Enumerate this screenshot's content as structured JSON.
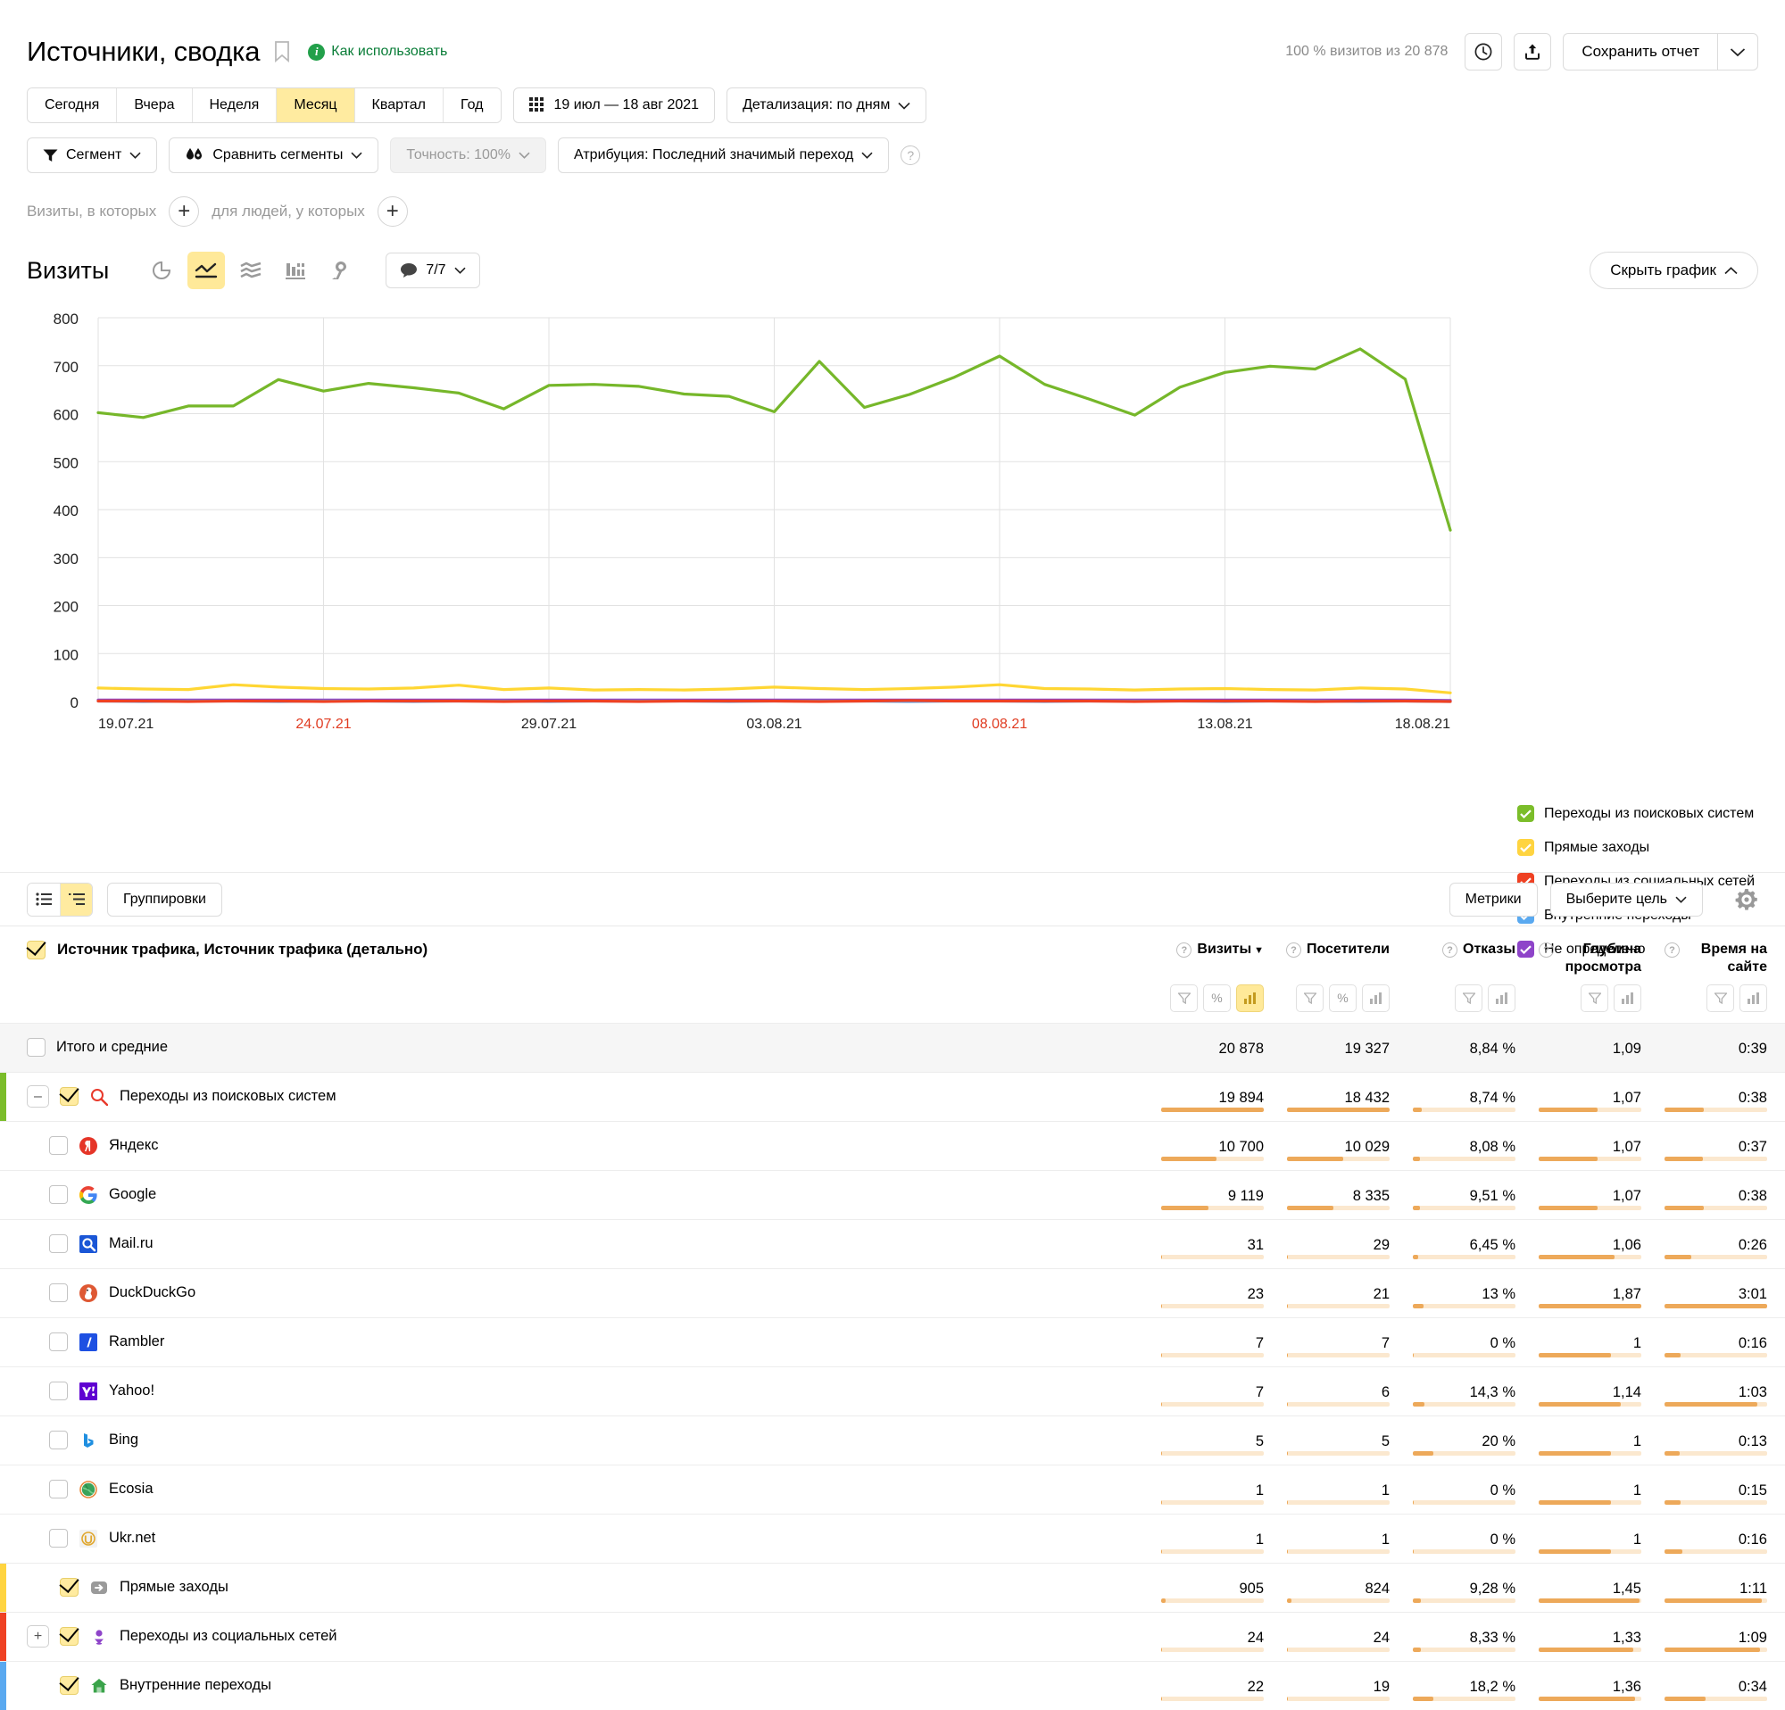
{
  "header": {
    "title": "Источники, сводка",
    "howto": "Как использовать",
    "visits_meta": "100 % визитов из 20 878",
    "save_label": "Сохранить отчет",
    "icons": {
      "bookmark": "bookmark-icon",
      "history": "clock-icon",
      "export": "export-icon"
    }
  },
  "period": {
    "items": [
      "Сегодня",
      "Вчера",
      "Неделя",
      "Месяц",
      "Квартал",
      "Год"
    ],
    "active": "Месяц",
    "date_range": "19 июл — 18 авг 2021",
    "detail": "Детализация: по дням"
  },
  "filters": {
    "segment": "Сегмент",
    "compare": "Сравнить сегменты",
    "accuracy": "Точность: 100%",
    "attribution": "Атрибуция: Последний значимый переход",
    "visits_label": "Визиты, в которых",
    "people_label": "для людей, у которых",
    "plus": "+"
  },
  "chart_controls": {
    "metric": "Визиты",
    "comments": "7/7",
    "hide_chart": "Скрыть график",
    "viz_buttons": [
      "pie-chart-icon",
      "line-chart-icon",
      "area-chart-icon",
      "bar-chart-icon",
      "map-icon"
    ],
    "active_viz": "line-chart-icon"
  },
  "chart_data": {
    "type": "line",
    "title": "Визиты",
    "xlabel": "",
    "ylabel": "",
    "ylim": [
      0,
      800
    ],
    "yticks": [
      0,
      100,
      200,
      300,
      400,
      500,
      600,
      700,
      800
    ],
    "grid": true,
    "legend_position": "right",
    "x": [
      "19.07.21",
      "20.07.21",
      "21.07.21",
      "22.07.21",
      "23.07.21",
      "24.07.21",
      "25.07.21",
      "26.07.21",
      "27.07.21",
      "28.07.21",
      "29.07.21",
      "30.07.21",
      "31.07.21",
      "01.08.21",
      "02.08.21",
      "03.08.21",
      "04.08.21",
      "05.08.21",
      "06.08.21",
      "07.08.21",
      "08.08.21",
      "09.08.21",
      "10.08.21",
      "11.08.21",
      "12.08.21",
      "13.08.21",
      "14.08.21",
      "15.08.21",
      "16.08.21",
      "17.08.21",
      "18.08.21"
    ],
    "xtick_labels": [
      "19.07.21",
      "24.07.21",
      "29.07.21",
      "03.08.21",
      "08.08.21",
      "13.08.21",
      "18.08.21"
    ],
    "xtick_weekend": [
      "24.07.21",
      "08.08.21"
    ],
    "series": [
      {
        "name": "Переходы из поисковых систем",
        "color": "#76b72a",
        "values": [
          602,
          592,
          616,
          616,
          671,
          647,
          663,
          654,
          643,
          610,
          659,
          661,
          657,
          641,
          636,
          604,
          709,
          613,
          640,
          676,
          720,
          661,
          630,
          597,
          655,
          686,
          699,
          693,
          735,
          672,
          357
        ]
      },
      {
        "name": "Прямые заходы",
        "color": "#ffd633",
        "values": [
          28,
          26,
          25,
          35,
          30,
          27,
          26,
          28,
          34,
          25,
          28,
          24,
          25,
          24,
          26,
          30,
          27,
          25,
          27,
          30,
          35,
          27,
          26,
          24,
          26,
          27,
          25,
          24,
          28,
          26,
          18
        ]
      },
      {
        "name": "Переходы из социальных сетей",
        "color": "#ef4123",
        "values": [
          1,
          1,
          0,
          1,
          1,
          0,
          1,
          1,
          1,
          0,
          1,
          1,
          0,
          1,
          1,
          1,
          0,
          1,
          2,
          1,
          1,
          1,
          1,
          0,
          1,
          1,
          1,
          0,
          1,
          1,
          0
        ]
      },
      {
        "name": "Внутренние переходы",
        "color": "#5aa9f0",
        "values": [
          1,
          0,
          1,
          1,
          0,
          1,
          1,
          0,
          1,
          1,
          0,
          1,
          1,
          1,
          0,
          1,
          1,
          1,
          0,
          1,
          1,
          0,
          1,
          1,
          1,
          0,
          1,
          1,
          0,
          1,
          0
        ]
      },
      {
        "name": "Не определено",
        "color": "#8e44c9",
        "values": [
          3,
          3,
          3,
          3,
          3,
          3,
          3,
          3,
          3,
          3,
          3,
          3,
          3,
          3,
          3,
          3,
          3,
          3,
          3,
          3,
          3,
          3,
          3,
          3,
          3,
          3,
          3,
          3,
          3,
          3,
          2
        ]
      }
    ]
  },
  "legend": [
    {
      "label": "Переходы из поисковых систем",
      "color": "#7bbd2a",
      "checked": true
    },
    {
      "label": "Прямые заходы",
      "color": "#ffd440",
      "checked": true
    },
    {
      "label": "Переходы из социальных сетей",
      "color": "#ef4123",
      "checked": true
    },
    {
      "label": "Внутренние переходы",
      "color": "#5aa9f0",
      "checked": true
    },
    {
      "label": "Не определено",
      "color": "#8e44c9",
      "checked": true
    }
  ],
  "table_toolbar": {
    "groupings": "Группировки",
    "metrics": "Метрики",
    "goal": "Выберите цель"
  },
  "table": {
    "dimension_header": "Источник трафика, Источник трафика (детально)",
    "columns": [
      {
        "label": "Визиты",
        "sorted": true
      },
      {
        "label": "Посетители",
        "sorted": false
      },
      {
        "label": "Отказы",
        "sorted": false
      },
      {
        "label": "Глубина просмотра",
        "sorted": false
      },
      {
        "label": "Время на сайте",
        "sorted": false
      }
    ],
    "rows": [
      {
        "label": "Итого и средние",
        "icon": "",
        "accent": "",
        "checked": false,
        "expander": "",
        "indent": 0,
        "total": true,
        "values": [
          "20 878",
          "19 327",
          "8,84 %",
          "1,09",
          "0:39"
        ],
        "bars": [
          0,
          0,
          0,
          0,
          0
        ]
      },
      {
        "label": "Переходы из поисковых систем",
        "icon": "search-icon",
        "accent": "#7bbd2a",
        "checked": true,
        "expander": "−",
        "indent": 0,
        "total": false,
        "values": [
          "19 894",
          "18 432",
          "8,74 %",
          "1,07",
          "0:38"
        ],
        "bars": [
          100,
          100,
          8.8,
          57,
          38
        ]
      },
      {
        "label": "Яндекс",
        "icon": "yandex-icon",
        "accent": "",
        "checked": false,
        "expander": "",
        "indent": 1,
        "total": false,
        "values": [
          "10 700",
          "10 029",
          "8,08 %",
          "1,07",
          "0:37"
        ],
        "bars": [
          54,
          55,
          7,
          57,
          37
        ]
      },
      {
        "label": "Google",
        "icon": "google-icon",
        "accent": "",
        "checked": false,
        "expander": "",
        "indent": 1,
        "total": false,
        "values": [
          "9 119",
          "8 335",
          "9,51 %",
          "1,07",
          "0:38"
        ],
        "bars": [
          46,
          45,
          7,
          57,
          38
        ]
      },
      {
        "label": "Mail.ru",
        "icon": "mailru-icon",
        "accent": "",
        "checked": false,
        "expander": "",
        "indent": 1,
        "total": false,
        "values": [
          "31",
          "29",
          "6,45 %",
          "1,06",
          "0:26"
        ],
        "bars": [
          0.6,
          0.6,
          5,
          74,
          26
        ]
      },
      {
        "label": "DuckDuckGo",
        "icon": "duckduckgo-icon",
        "accent": "",
        "checked": false,
        "expander": "",
        "indent": 1,
        "total": false,
        "values": [
          "23",
          "21",
          "13 %",
          "1,87",
          "3:01"
        ],
        "bars": [
          0.5,
          0.5,
          10,
          100,
          100
        ]
      },
      {
        "label": "Rambler",
        "icon": "rambler-icon",
        "accent": "",
        "checked": false,
        "expander": "",
        "indent": 1,
        "total": false,
        "values": [
          "7",
          "7",
          "0 %",
          "1",
          "0:16"
        ],
        "bars": [
          0.3,
          0.3,
          0,
          70,
          16
        ]
      },
      {
        "label": "Yahoo!",
        "icon": "yahoo-icon",
        "accent": "",
        "checked": false,
        "expander": "",
        "indent": 1,
        "total": false,
        "values": [
          "7",
          "6",
          "14,3 %",
          "1,14",
          "1:03"
        ],
        "bars": [
          0.3,
          0.3,
          11,
          80,
          90
        ]
      },
      {
        "label": "Bing",
        "icon": "bing-icon",
        "accent": "",
        "checked": false,
        "expander": "",
        "indent": 1,
        "total": false,
        "values": [
          "5",
          "5",
          "20 %",
          "1",
          "0:13"
        ],
        "bars": [
          0.2,
          0.2,
          20,
          70,
          15
        ]
      },
      {
        "label": "Ecosia",
        "icon": "ecosia-icon",
        "accent": "",
        "checked": false,
        "expander": "",
        "indent": 1,
        "total": false,
        "values": [
          "1",
          "1",
          "0 %",
          "1",
          "0:15"
        ],
        "bars": [
          0.1,
          0.1,
          0,
          70,
          16
        ]
      },
      {
        "label": "Ukr.net",
        "icon": "ukrnet-icon",
        "accent": "",
        "checked": false,
        "expander": "",
        "indent": 1,
        "total": false,
        "values": [
          "1",
          "1",
          "0 %",
          "1",
          "0:16"
        ],
        "bars": [
          0.1,
          0.1,
          0,
          70,
          17
        ]
      },
      {
        "label": "Прямые заходы",
        "icon": "direct-arrow-icon",
        "accent": "#ffd440",
        "checked": true,
        "expander": "",
        "indent": 0,
        "total": false,
        "values": [
          "905",
          "824",
          "9,28 %",
          "1,45",
          "1:11"
        ],
        "bars": [
          4.5,
          4,
          8,
          98,
          95
        ]
      },
      {
        "label": "Переходы из социальных сетей",
        "icon": "social-icon",
        "accent": "#ef4123",
        "checked": true,
        "expander": "+",
        "indent": 0,
        "total": false,
        "values": [
          "24",
          "24",
          "8,33 %",
          "1,33",
          "1:09"
        ],
        "bars": [
          0.5,
          0.5,
          8,
          92,
          93
        ]
      },
      {
        "label": "Внутренние переходы",
        "icon": "home-icon",
        "accent": "#5aa9f0",
        "checked": true,
        "expander": "",
        "indent": 0,
        "total": false,
        "values": [
          "22",
          "19",
          "18,2 %",
          "1,36",
          "0:34"
        ],
        "bars": [
          0.5,
          0.4,
          20,
          94,
          40
        ]
      }
    ]
  }
}
